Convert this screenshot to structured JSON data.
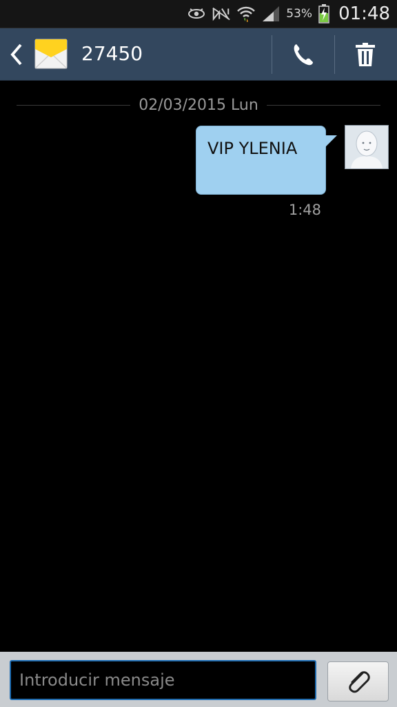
{
  "status_bar": {
    "battery_percent": "53%",
    "time": "01:48",
    "icons": [
      "eye-icon",
      "nfc-muted-icon",
      "wifi-icon",
      "signal-icon",
      "battery-charging-icon"
    ]
  },
  "header": {
    "title": "27450",
    "app_icon": "envelope-icon",
    "back_icon": "chevron-left-icon",
    "call_icon": "phone-icon",
    "delete_icon": "trash-icon"
  },
  "conversation": {
    "date_separator": "02/03/2015 Lun",
    "messages": [
      {
        "text": "VIP YLENIA",
        "time": "1:48",
        "avatar_icon": "contact-avatar-icon"
      }
    ]
  },
  "compose": {
    "placeholder": "Introducir mensaje",
    "value": "",
    "attach_icon": "paperclip-icon"
  },
  "colors": {
    "action_bar": "#33475e",
    "bubble": "#9fd0f0",
    "background": "#000000",
    "input_border": "#1e6bb0"
  }
}
